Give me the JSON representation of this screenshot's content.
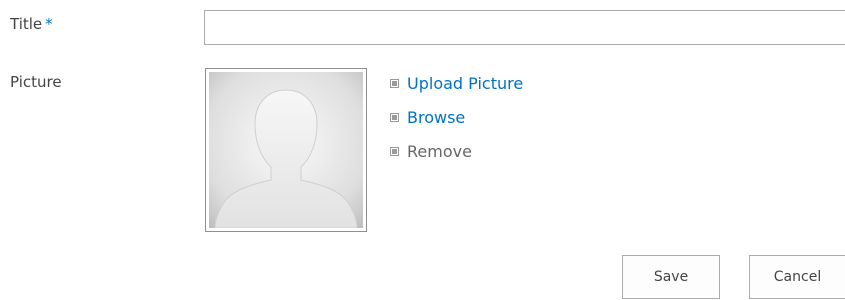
{
  "form": {
    "title_field": {
      "label": "Title",
      "required_marker": "*",
      "value": "",
      "placeholder": ""
    },
    "picture_field": {
      "label": "Picture",
      "actions": [
        {
          "label": "Upload Picture",
          "icon": "bullet-icon",
          "enabled": true
        },
        {
          "label": "Browse",
          "icon": "bullet-icon",
          "enabled": true
        },
        {
          "label": "Remove",
          "icon": "bullet-icon",
          "enabled": false
        }
      ],
      "placeholder_image": "person-silhouette-icon"
    }
  },
  "buttons": {
    "save_label": "Save",
    "cancel_label": "Cancel"
  },
  "colors": {
    "link": "#0072c6",
    "required": "#0072c6",
    "text": "#444444",
    "disabled": "#666666",
    "border": "#ababab"
  }
}
